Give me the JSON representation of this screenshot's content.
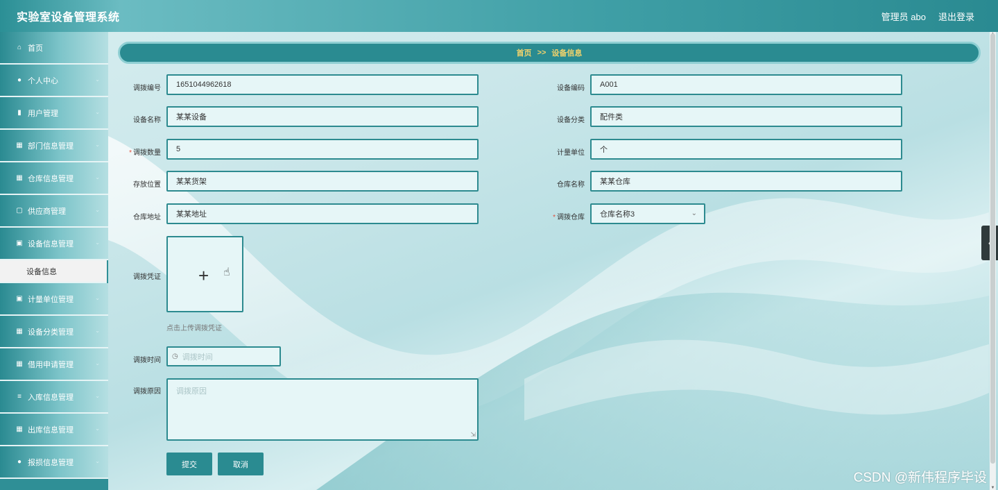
{
  "app": {
    "title": "实验室设备管理系统"
  },
  "header": {
    "user_label": "管理员 abo",
    "logout_label": "退出登录"
  },
  "sidebar": {
    "items": [
      {
        "label": "首页",
        "icon": "home-icon"
      },
      {
        "label": "个人中心",
        "icon": "user-icon"
      },
      {
        "label": "用户管理",
        "icon": "bar-chart-icon"
      },
      {
        "label": "部门信息管理",
        "icon": "grid-icon"
      },
      {
        "label": "仓库信息管理",
        "icon": "grid-icon"
      },
      {
        "label": "供应商管理",
        "icon": "briefcase-icon"
      },
      {
        "label": "设备信息管理",
        "icon": "clipboard-icon"
      },
      {
        "label": "计量单位管理",
        "icon": "clipboard-icon"
      },
      {
        "label": "设备分类管理",
        "icon": "grid-icon"
      },
      {
        "label": "借用申请管理",
        "icon": "grid-icon"
      },
      {
        "label": "入库信息管理",
        "icon": "list-icon"
      },
      {
        "label": "出库信息管理",
        "icon": "table-icon"
      },
      {
        "label": "报损信息管理",
        "icon": "user-icon"
      }
    ],
    "active_sub": "设备信息"
  },
  "breadcrumb": {
    "home": "首页",
    "separator": ">>",
    "current": "设备信息"
  },
  "form": {
    "transfer_no": {
      "label": "调拨编号",
      "value": "1651044962618"
    },
    "device_code": {
      "label": "设备编码",
      "value": "A001"
    },
    "device_name": {
      "label": "设备名称",
      "value": "某某设备"
    },
    "device_category": {
      "label": "设备分类",
      "value": "配件类"
    },
    "transfer_qty": {
      "label": "调拨数量",
      "value": "5",
      "required_mark": "*"
    },
    "unit": {
      "label": "计量单位",
      "value": "个"
    },
    "location": {
      "label": "存放位置",
      "value": "某某货架"
    },
    "warehouse_name": {
      "label": "仓库名称",
      "value": "某某仓库"
    },
    "warehouse_address": {
      "label": "仓库地址",
      "value": "某某地址"
    },
    "target_warehouse": {
      "label": "调拨仓库",
      "value": "仓库名称3",
      "required_mark": "*"
    },
    "voucher": {
      "label": "调拨凭证",
      "hint": "点击上传调拨凭证"
    },
    "transfer_time": {
      "label": "调拨时间",
      "placeholder": "调拨时间"
    },
    "transfer_reason": {
      "label": "调拨原因",
      "placeholder": "调拨原因"
    }
  },
  "buttons": {
    "submit": "提交",
    "cancel": "取消"
  },
  "watermark": "CSDN @新伟程序毕设"
}
